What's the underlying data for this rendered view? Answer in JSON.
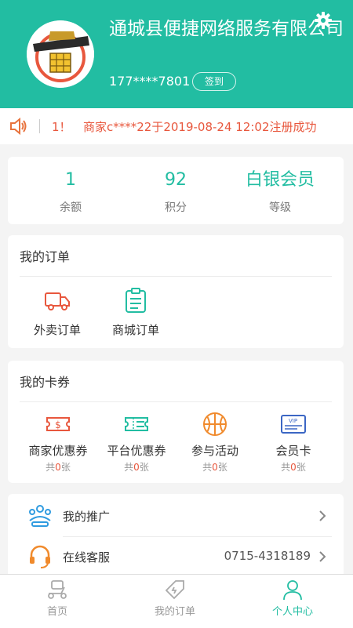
{
  "header": {
    "shop_name": "通城县便捷网络服务有限公司",
    "phone": "177****7801",
    "signin_label": "签到"
  },
  "notice": {
    "prefix": "1！",
    "text": "商家c****22于2019-08-24 12:02注册成功"
  },
  "stats": [
    {
      "value": "1",
      "label": "余额"
    },
    {
      "value": "92",
      "label": "积分"
    },
    {
      "value": "白银会员",
      "label": "等级"
    }
  ],
  "orders": {
    "title": "我的订单",
    "items": [
      {
        "label": "外卖订单",
        "icon": "truck-icon"
      },
      {
        "label": "商城订单",
        "icon": "clipboard-icon"
      }
    ]
  },
  "coupons": {
    "title": "我的卡券",
    "items": [
      {
        "label": "商家优惠券",
        "count_prefix": "共",
        "count": "0",
        "count_suffix": "张",
        "icon": "dollar-ticket-icon"
      },
      {
        "label": "平台优惠券",
        "count_prefix": "共",
        "count": "0",
        "count_suffix": "张",
        "icon": "ticket-icon"
      },
      {
        "label": "参与活动",
        "count_prefix": "共",
        "count": "0",
        "count_suffix": "张",
        "icon": "basketball-icon"
      },
      {
        "label": "会员卡",
        "count_prefix": "共",
        "count": "0",
        "count_suffix": "张",
        "icon": "vip-card-icon",
        "card_text": "VIP"
      }
    ]
  },
  "menu": [
    {
      "label": "我的推广",
      "value": "",
      "icon": "promotion-icon"
    },
    {
      "label": "在线客服",
      "value": "0715-4318189",
      "icon": "headset-icon"
    }
  ],
  "tabbar": [
    {
      "label": "首页",
      "icon": "scooter-icon",
      "active": false
    },
    {
      "label": "我的订单",
      "icon": "order-tag-icon",
      "active": false
    },
    {
      "label": "个人中心",
      "icon": "person-icon",
      "active": true
    }
  ],
  "colors": {
    "primary": "#22bda2",
    "accent_red": "#e8573d"
  }
}
